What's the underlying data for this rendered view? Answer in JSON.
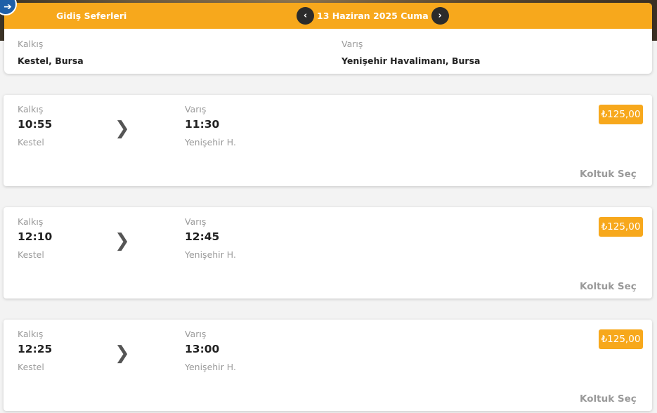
{
  "header": {
    "title": "Gidiş Seferleri",
    "date": "13 Haziran 2025 Cuma"
  },
  "route": {
    "departure_label": "Kalkış",
    "departure_value": "Kestel, Bursa",
    "arrival_label": "Varış",
    "arrival_value": "Yenişehir Havalimanı, Bursa"
  },
  "trips": [
    {
      "dep_label": "Kalkış",
      "dep_time": "10:55",
      "dep_stop": "Kestel",
      "arr_label": "Varış",
      "arr_time": "11:30",
      "arr_stop": "Yenişehir H.",
      "price": "₺125,00",
      "action": "Koltuk Seç"
    },
    {
      "dep_label": "Kalkış",
      "dep_time": "12:10",
      "dep_stop": "Kestel",
      "arr_label": "Varış",
      "arr_time": "12:45",
      "arr_stop": "Yenişehir H.",
      "price": "₺125,00",
      "action": "Koltuk Seç"
    },
    {
      "dep_label": "Kalkış",
      "dep_time": "12:25",
      "dep_stop": "Kestel",
      "arr_label": "Varış",
      "arr_time": "13:00",
      "arr_stop": "Yenişehir H.",
      "price": "₺125,00",
      "action": "Koltuk Seç"
    }
  ],
  "icons": {
    "back": "arrow-right-icon",
    "prev_date": "chevron-left-icon",
    "next_date": "chevron-right-icon",
    "trip_arrow": "chevron-right-icon"
  },
  "colors": {
    "accent": "#f7a81c",
    "nav_button": "#2b2b2b",
    "back_button": "#1f5fa8"
  }
}
